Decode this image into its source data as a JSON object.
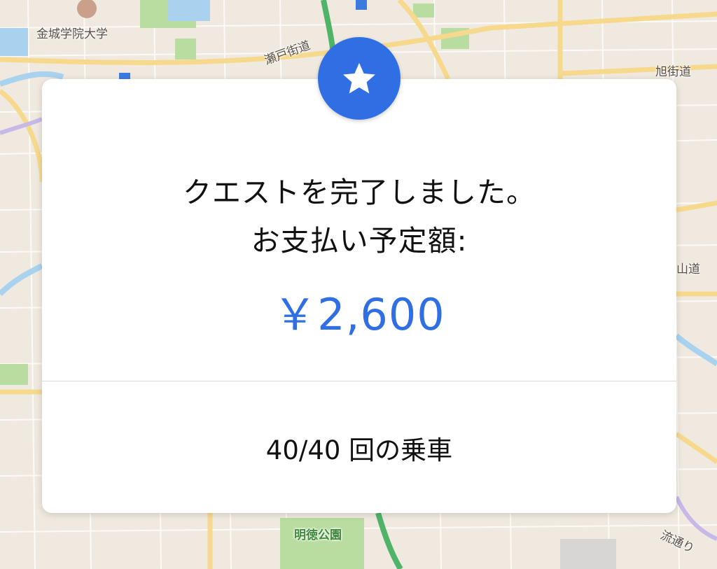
{
  "map": {
    "labels": {
      "university": "金城学院大学",
      "seto_kaido": "瀬戸街道",
      "asahi_kaido": "旭街道",
      "yamamichi": "山道",
      "meitoku_park": "明徳公園",
      "nagare_dori": "流通り"
    },
    "road_color": "#f7d98e",
    "park_color": "#b9dca0",
    "water_color": "#a8d2ee",
    "rail_color": "#4fb36a"
  },
  "dialog": {
    "icon": "star-icon",
    "message_line1": "クエストを完了しました。",
    "message_line2": "お支払い予定額:",
    "amount": "￥2,600",
    "amount_color": "#2f6fe3",
    "rides": "40/40 回の乗車"
  }
}
